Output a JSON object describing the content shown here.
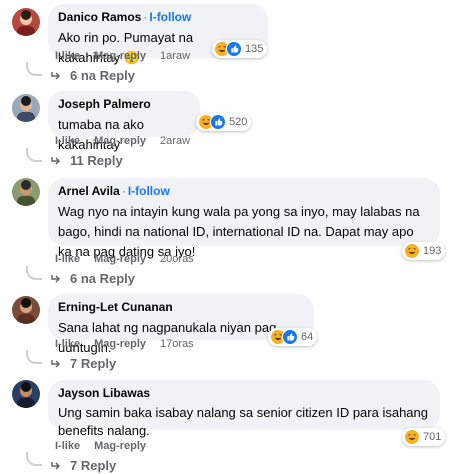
{
  "actions": {
    "like": "I-like",
    "reply": "Mag-reply"
  },
  "comments": [
    {
      "author": "Danico Ramos",
      "follow": "I-follow",
      "text": "Ako rin po. Pumayat na kakahintay 😔",
      "reaction_count": "135",
      "reactions": [
        "haha",
        "like"
      ],
      "time": "1araw",
      "replies": "6 na Reply"
    },
    {
      "author": "Joseph Palmero",
      "follow": "",
      "text": "tumaba na ako kakahintay",
      "reaction_count": "520",
      "reactions": [
        "haha",
        "like"
      ],
      "time": "2araw",
      "replies": "11 Reply"
    },
    {
      "author": "Arnel Avila",
      "follow": "I-follow",
      "text": "Wag nyo na intayin kung wala pa yong sa inyo, may lalabas na bago, hindi na national ID, international ID na. Dapat may apo ka na pag dating sa iyo!",
      "reaction_count": "193",
      "reactions": [
        "haha"
      ],
      "time": "20oras",
      "replies": "6 na Reply"
    },
    {
      "author": "Erning-Let Cunanan",
      "follow": "",
      "text": "Sana lahat ng nagpanukala niyan pag-uuntugin.",
      "reaction_count": "64",
      "reactions": [
        "haha",
        "like"
      ],
      "time": "17oras",
      "replies": "7 Reply"
    },
    {
      "author": "Jayson Libawas",
      "follow": "",
      "text": "Ung samin baka isabay nalang sa senior citizen ID para isahang benefits nalang.",
      "reaction_count": "701",
      "reactions": [
        "haha"
      ],
      "time": "",
      "replies": "7 Reply"
    }
  ],
  "colors": {
    "accent": "#1877f2",
    "bubble": "#f0f2f5",
    "muted": "#65676b"
  }
}
